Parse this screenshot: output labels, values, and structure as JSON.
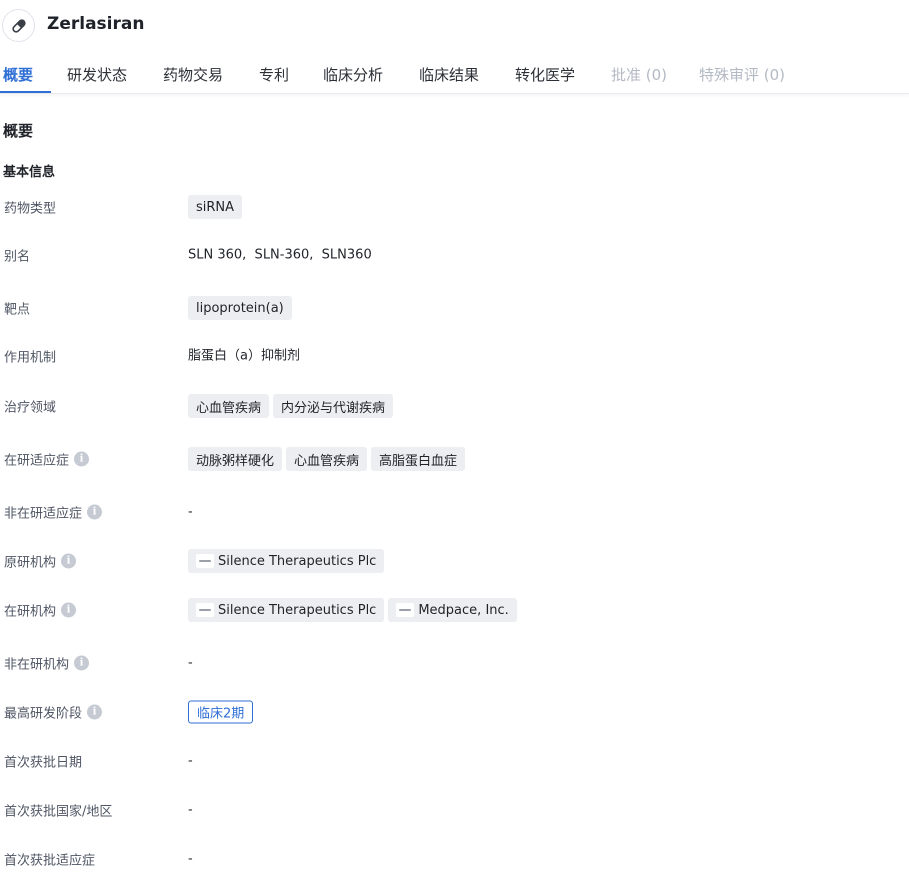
{
  "header": {
    "title": "Zerlasiran",
    "icon": "pill-icon"
  },
  "tabs": [
    {
      "label": "概要",
      "state": "active"
    },
    {
      "label": "研发状态",
      "state": "normal"
    },
    {
      "label": "药物交易",
      "state": "normal"
    },
    {
      "label": "专利",
      "state": "normal"
    },
    {
      "label": "临床分析",
      "state": "normal"
    },
    {
      "label": "临床结果",
      "state": "normal"
    },
    {
      "label": "转化医学",
      "state": "normal"
    },
    {
      "label": "批准 (0)",
      "state": "disabled"
    },
    {
      "label": "特殊审评 (0)",
      "state": "disabled"
    }
  ],
  "section": {
    "title": "概要",
    "subtitle": "基本信息"
  },
  "rows": {
    "drug_type": {
      "label": "药物类型",
      "tags": [
        "siRNA"
      ]
    },
    "aliases": {
      "label": "别名",
      "text": "SLN 360,  SLN-360,  SLN360"
    },
    "target": {
      "label": "靶点",
      "tags": [
        "lipoprotein(a)"
      ]
    },
    "mechanism": {
      "label": "作用机制",
      "text": "脂蛋白（a）抑制剂"
    },
    "therapeutic_area": {
      "label": "治疗领域",
      "tags": [
        "心血管疾病",
        "内分泌与代谢疾病"
      ]
    },
    "active_indications": {
      "label": "在研适应症",
      "tags": [
        "动脉粥样硬化",
        "心血管疾病",
        "高脂蛋白血症"
      ]
    },
    "inactive_indications": {
      "label": "非在研适应症",
      "text": "-"
    },
    "originator": {
      "label": "原研机构",
      "orgs": [
        "Silence Therapeutics Plc"
      ]
    },
    "active_orgs": {
      "label": "在研机构",
      "orgs": [
        "Silence Therapeutics Plc",
        "Medpace, Inc."
      ]
    },
    "inactive_orgs": {
      "label": "非在研机构",
      "text": "-"
    },
    "highest_phase": {
      "label": "最高研发阶段",
      "phase": "临床2期"
    },
    "first_approval_date": {
      "label": "首次获批日期",
      "text": "-"
    },
    "first_approval_country": {
      "label": "首次获批国家/地区",
      "text": "-"
    },
    "first_approval_indication": {
      "label": "首次获批适应症",
      "text": "-"
    }
  },
  "colors": {
    "accent": "#2f6fd6",
    "tag_bg": "#eceef2",
    "disabled_tab": "#b4bac4"
  }
}
